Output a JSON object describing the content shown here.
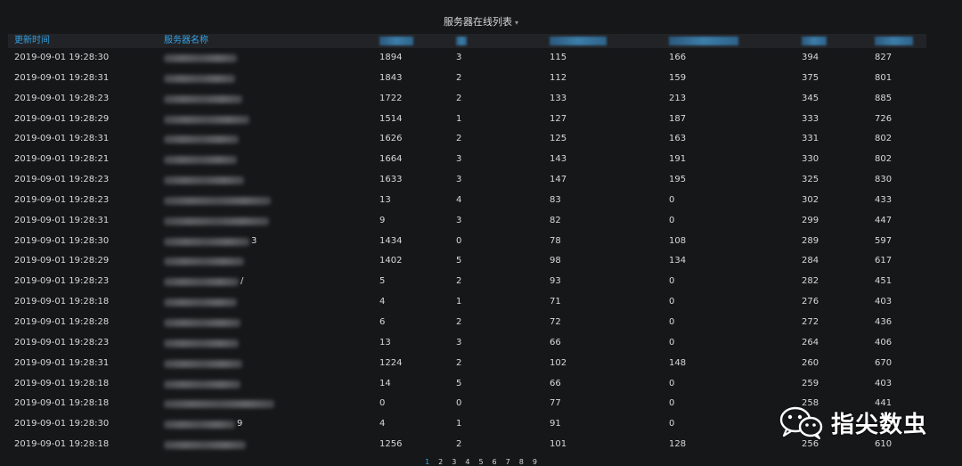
{
  "panel": {
    "title": "服务器在线列表",
    "caret": "▾"
  },
  "columns": [
    {
      "label": "更新时间"
    },
    {
      "label": "服务器名称"
    },
    {
      "label": ""
    },
    {
      "label": ""
    },
    {
      "label": ""
    },
    {
      "label": ""
    },
    {
      "label": ""
    },
    {
      "label": ""
    }
  ],
  "rows": [
    {
      "time": "2019-09-01 19:28:30",
      "name_suffix": "",
      "c3": "1894",
      "c4": "3",
      "c5": "115",
      "c6": "166",
      "c7": "394",
      "c8": "827"
    },
    {
      "time": "2019-09-01 19:28:31",
      "name_suffix": "",
      "c3": "1843",
      "c4": "2",
      "c5": "112",
      "c6": "159",
      "c7": "375",
      "c8": "801"
    },
    {
      "time": "2019-09-01 19:28:23",
      "name_suffix": "",
      "c3": "1722",
      "c4": "2",
      "c5": "133",
      "c6": "213",
      "c7": "345",
      "c8": "885"
    },
    {
      "time": "2019-09-01 19:28:29",
      "name_suffix": "",
      "c3": "1514",
      "c4": "1",
      "c5": "127",
      "c6": "187",
      "c7": "333",
      "c8": "726"
    },
    {
      "time": "2019-09-01 19:28:31",
      "name_suffix": "",
      "c3": "1626",
      "c4": "2",
      "c5": "125",
      "c6": "163",
      "c7": "331",
      "c8": "802"
    },
    {
      "time": "2019-09-01 19:28:21",
      "name_suffix": "",
      "c3": "1664",
      "c4": "3",
      "c5": "143",
      "c6": "191",
      "c7": "330",
      "c8": "802"
    },
    {
      "time": "2019-09-01 19:28:23",
      "name_suffix": "",
      "c3": "1633",
      "c4": "3",
      "c5": "147",
      "c6": "195",
      "c7": "325",
      "c8": "830"
    },
    {
      "time": "2019-09-01 19:28:23",
      "name_suffix": "",
      "c3": "13",
      "c4": "4",
      "c5": "83",
      "c6": "0",
      "c7": "302",
      "c8": "433"
    },
    {
      "time": "2019-09-01 19:28:31",
      "name_suffix": "",
      "c3": "9",
      "c4": "3",
      "c5": "82",
      "c6": "0",
      "c7": "299",
      "c8": "447"
    },
    {
      "time": "2019-09-01 19:28:30",
      "name_suffix": "3",
      "c3": "1434",
      "c4": "0",
      "c5": "78",
      "c6": "108",
      "c7": "289",
      "c8": "597"
    },
    {
      "time": "2019-09-01 19:28:29",
      "name_suffix": "",
      "c3": "1402",
      "c4": "5",
      "c5": "98",
      "c6": "134",
      "c7": "284",
      "c8": "617"
    },
    {
      "time": "2019-09-01 19:28:23",
      "name_suffix": "/",
      "c3": "5",
      "c4": "2",
      "c5": "93",
      "c6": "0",
      "c7": "282",
      "c8": "451"
    },
    {
      "time": "2019-09-01 19:28:18",
      "name_suffix": "",
      "c3": "4",
      "c4": "1",
      "c5": "71",
      "c6": "0",
      "c7": "276",
      "c8": "403"
    },
    {
      "time": "2019-09-01 19:28:28",
      "name_suffix": "",
      "c3": "6",
      "c4": "2",
      "c5": "72",
      "c6": "0",
      "c7": "272",
      "c8": "436"
    },
    {
      "time": "2019-09-01 19:28:23",
      "name_suffix": "",
      "c3": "13",
      "c4": "3",
      "c5": "66",
      "c6": "0",
      "c7": "264",
      "c8": "406"
    },
    {
      "time": "2019-09-01 19:28:31",
      "name_suffix": "",
      "c3": "1224",
      "c4": "2",
      "c5": "102",
      "c6": "148",
      "c7": "260",
      "c8": "670"
    },
    {
      "time": "2019-09-01 19:28:18",
      "name_suffix": "",
      "c3": "14",
      "c4": "5",
      "c5": "66",
      "c6": "0",
      "c7": "259",
      "c8": "403"
    },
    {
      "time": "2019-09-01 19:28:18",
      "name_suffix": "",
      "c3": "0",
      "c4": "0",
      "c5": "77",
      "c6": "0",
      "c7": "258",
      "c8": "441"
    },
    {
      "time": "2019-09-01 19:28:30",
      "name_suffix": "9",
      "c3": "4",
      "c4": "1",
      "c5": "91",
      "c6": "0",
      "c7": "",
      "c8": ""
    },
    {
      "time": "2019-09-01 19:28:18",
      "name_suffix": "",
      "c3": "1256",
      "c4": "2",
      "c5": "101",
      "c6": "128",
      "c7": "256",
      "c8": "610"
    }
  ],
  "pagination": {
    "pages": [
      "1",
      "2",
      "3",
      "4",
      "5",
      "6",
      "7",
      "8",
      "9"
    ],
    "active": "1"
  },
  "watermark": {
    "text": "指尖数虫",
    "icon": "wechat-logo-icon"
  },
  "colors": {
    "background": "#161719",
    "header_text": "#33a2e5",
    "header_bg": "#222326",
    "text": "#d8d9da"
  }
}
